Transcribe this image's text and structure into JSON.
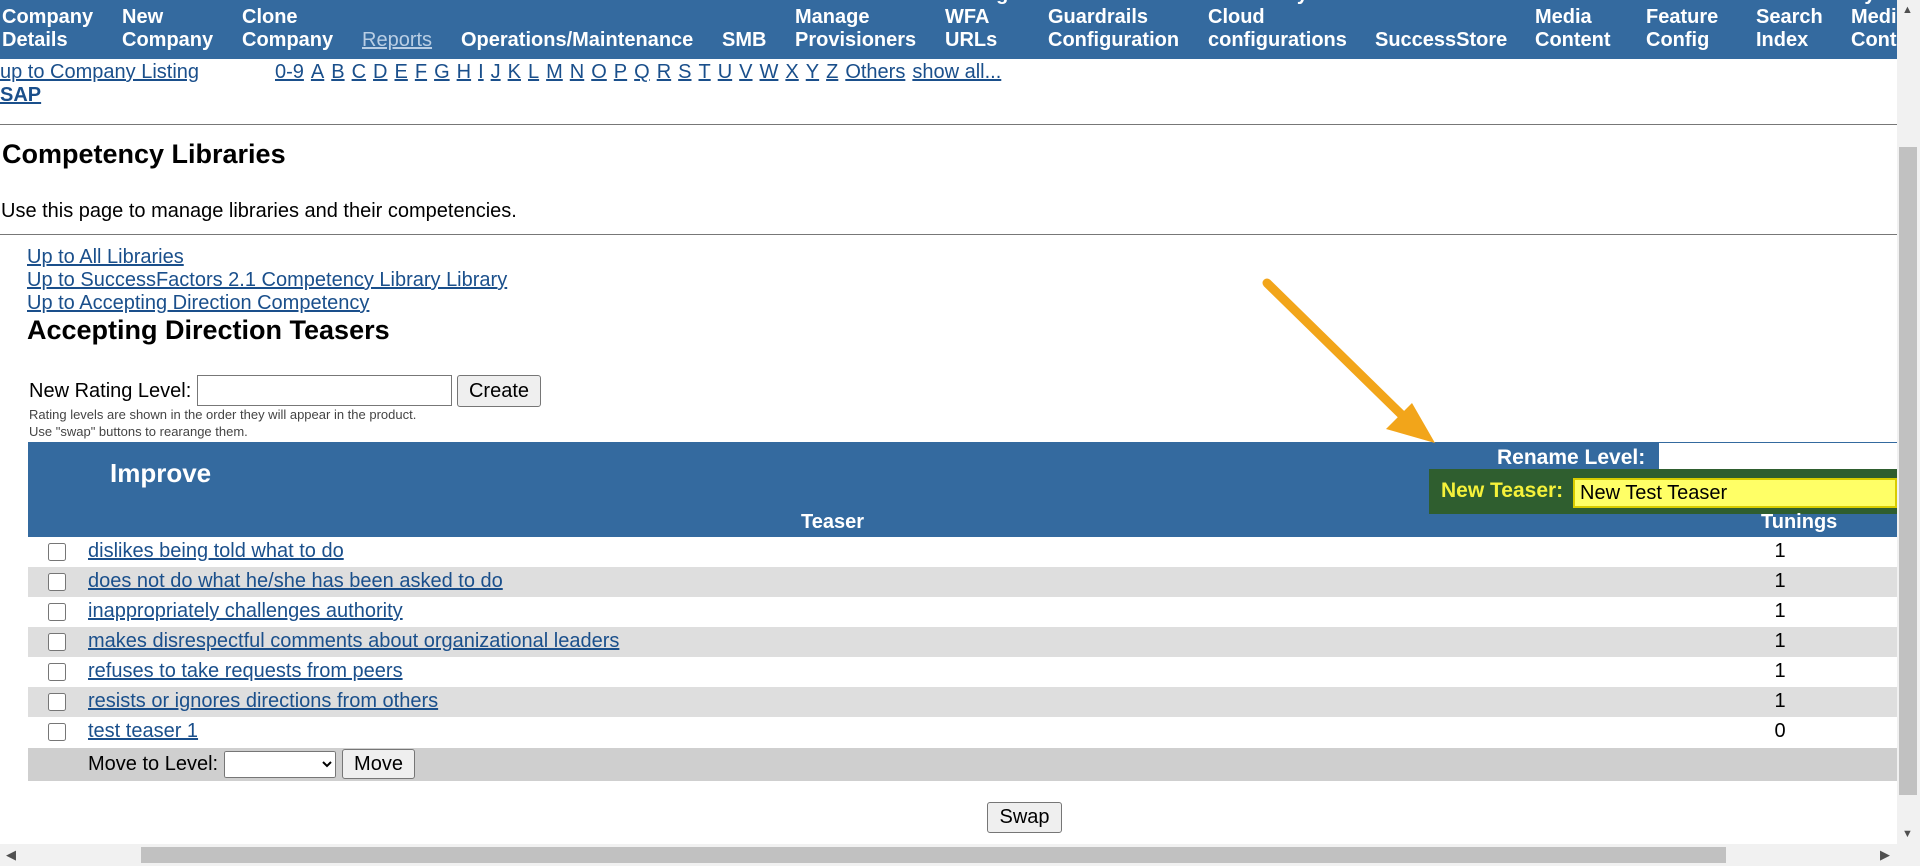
{
  "topnav": [
    "Company\nDetails",
    "New\nCompany",
    "Clone\nCompany",
    "Reports",
    "Operations/Maintenance",
    "SMB",
    "Manage\nProvisioners",
    "Manage\nWFA\nURLs",
    "Custom\nGuardrails\nConfiguration",
    "SAP Analytics\nCloud\nconfigurations",
    "SuccessStore",
    "Content\nMedia\nContent",
    "Content\nFeature\nConfig",
    "Search\nIndex",
    "Sync\nMedia\nContent"
  ],
  "breadcrumb": {
    "up_company": "up to Company Listing",
    "company": "SAP"
  },
  "alpha": [
    "0-9",
    "A",
    "B",
    "C",
    "D",
    "E",
    "F",
    "G",
    "H",
    "I",
    "J",
    "K",
    "L",
    "M",
    "N",
    "O",
    "P",
    "Q",
    "R",
    "S",
    "T",
    "U",
    "V",
    "W",
    "X",
    "Y",
    "Z",
    "Others",
    "show all..."
  ],
  "page": {
    "title": "Competency Libraries",
    "description": "Use this page to manage libraries and their competencies."
  },
  "uplinks": {
    "all": "Up to All Libraries",
    "library": "Up to SuccessFactors 2.1 Competency Library Library",
    "competency": "Up to Accepting Direction Competency"
  },
  "section_title": "Accepting Direction Teasers",
  "new_rating": {
    "label": "New Rating Level:",
    "value": "",
    "create": "Create",
    "hint1": "Rating levels are shown in the order they will appear in the product.",
    "hint2": "Use \"swap\" buttons to rearange them."
  },
  "level": {
    "name": "Improve",
    "rename_label": "Rename Level:",
    "new_teaser_label": "New Teaser:",
    "new_teaser_value": "New Test Teaser",
    "col_teaser": "Teaser",
    "col_tunings": "Tunings"
  },
  "teasers": [
    {
      "text": "dislikes being told what to do",
      "tunings": "1"
    },
    {
      "text": "does not do what he/she has been asked to do",
      "tunings": "1"
    },
    {
      "text": "inappropriately challenges authority",
      "tunings": "1"
    },
    {
      "text": "makes disrespectful comments about organizational leaders",
      "tunings": "1"
    },
    {
      "text": "refuses to take requests from peers",
      "tunings": "1"
    },
    {
      "text": "resists or ignores directions from others",
      "tunings": "1"
    },
    {
      "text": "test teaser 1",
      "tunings": "0"
    }
  ],
  "move": {
    "label": "Move to Level:",
    "selected": "",
    "button": "Move"
  },
  "swap_label": "Swap",
  "colors": {
    "header": "#346a9f",
    "highlight": "#ffff66",
    "arrow": "#f2a51a"
  }
}
